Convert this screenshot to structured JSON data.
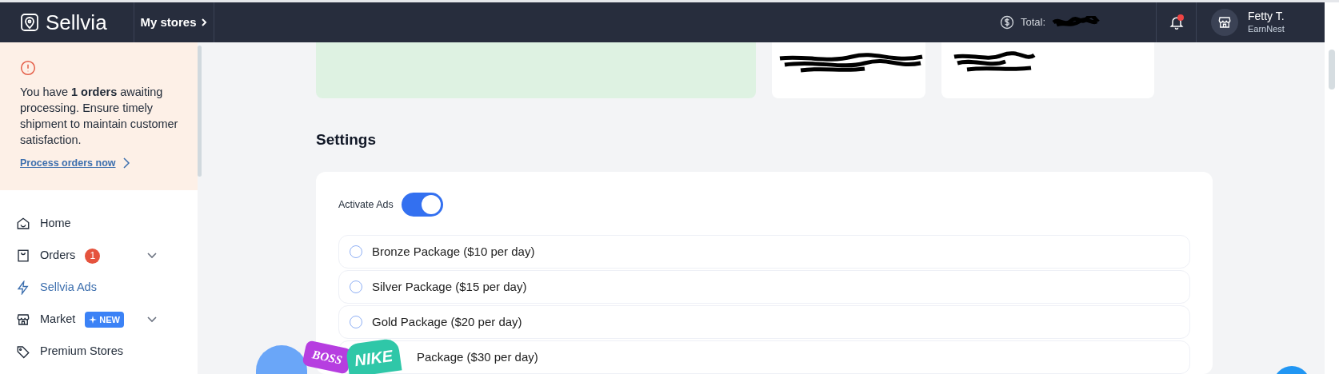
{
  "header": {
    "logo": "Sellvia",
    "stores_link": "My stores",
    "total_label": "Total:",
    "unread": true,
    "user": {
      "name": "Fetty T.",
      "store": "EarnNest"
    }
  },
  "alert": {
    "message": "You have **1 orders** awaiting processing. Ensure timely shipment to maintain customer satisfaction.",
    "link": "Process orders now"
  },
  "nav": [
    {
      "label": "Home",
      "selected": false,
      "expandable": false
    },
    {
      "label": "Orders",
      "selected": false,
      "expandable": true,
      "badge": "1"
    },
    {
      "label": "Sellvia Ads",
      "selected": true,
      "expandable": false
    },
    {
      "label": "Market",
      "selected": false,
      "expandable": true,
      "tag": "NEW"
    },
    {
      "label": "Premium Stores",
      "selected": false,
      "expandable": false
    }
  ],
  "settings": {
    "title": "Settings",
    "activate_ads": {
      "label": "Activate Ads",
      "on": true
    },
    "packages": [
      {
        "label": "Bronze Package ($10 per day)",
        "selected": false
      },
      {
        "label": "Silver Package ($15 per day)",
        "selected": false
      },
      {
        "label": "Gold Package ($20 per day)",
        "selected": false
      },
      {
        "label": "Package ($30 per day)"
      }
    ]
  },
  "promo_stickers": [
    "BOSS",
    "NIKE"
  ]
}
